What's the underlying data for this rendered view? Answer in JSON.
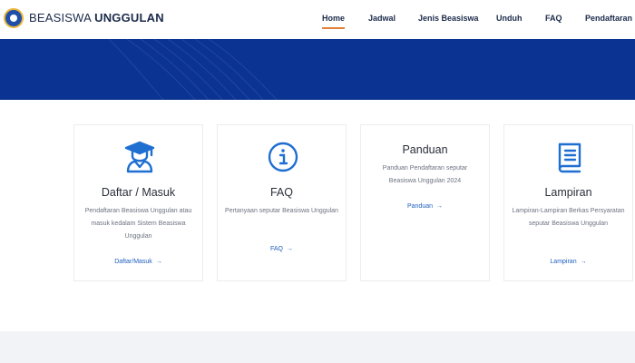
{
  "brand": {
    "light": "BEASISWA ",
    "bold": "UNGGULAN"
  },
  "nav": [
    {
      "label": "Home",
      "active": true
    },
    {
      "label": "Jadwal"
    },
    {
      "label": "Jenis Beasiswa"
    },
    {
      "label": "Unduh"
    },
    {
      "label": "FAQ"
    },
    {
      "label": "Pendaftaran"
    }
  ],
  "colors": {
    "primary": "#0b3391",
    "accent": "#e0823a",
    "link": "#1f5fbf",
    "icon": "#1f6fd1"
  },
  "cards": [
    {
      "icon": "graduate-icon",
      "title": "Daftar / Masuk",
      "desc": "Pendaftaran Beasiswa Unggulan atau masuk kedalam Sistem Beasiswa Unggulan",
      "link": "Daftar/Masuk"
    },
    {
      "icon": "info-icon",
      "title": "FAQ",
      "desc": "Pertanyaan seputar Beasiswa Unggulan",
      "link": "FAQ"
    },
    {
      "icon": "",
      "title": "Panduan",
      "desc": "Panduan Pendaftaran seputar Beasiswa Unggulan 2024",
      "link": "Panduan"
    },
    {
      "icon": "book-icon",
      "title": "Lampiran",
      "desc": "Lampiran-Lampiran Berkas Persyaratan seputar Beasiswa Unggulan",
      "link": "Lampiran"
    }
  ],
  "arrow": "→"
}
